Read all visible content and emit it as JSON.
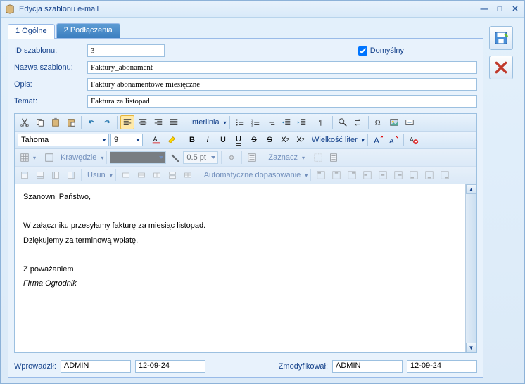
{
  "title": "Edycja szablonu e-mail",
  "tabs": {
    "general": "1 Ogólne",
    "connections": "2 Podłączenia"
  },
  "fields": {
    "id_label": "ID szablonu:",
    "id_value": "3",
    "default_label": "Domyślny",
    "default_checked": true,
    "name_label": "Nazwa szablonu:",
    "name_value": "Faktury_abonament",
    "desc_label": "Opis:",
    "desc_value": "Faktury abonamentowe miesięczne",
    "subject_label": "Temat:",
    "subject_value": "Faktura za listopad"
  },
  "toolbar": {
    "font_family": "Tahoma",
    "font_size": "9",
    "interlinia": "Interlinia",
    "wielkosc": "Wielkość liter",
    "krawedzie": "Krawędzie",
    "pt": "0.5 pt",
    "zaznacz": "Zaznacz",
    "usun": "Usuń",
    "auto": "Automatyczne dopasowanie"
  },
  "body": {
    "greeting": "Szanowni Państwo,",
    "l1": "W załączniku przesyłamy fakturę za miesiąc listopad.",
    "l2": "Dziękujemy za terminową wpłatę.",
    "sign1": "Z poważaniem",
    "sign2": "Firma Ogrodnik"
  },
  "footer": {
    "created_label": "Wprowadził:",
    "created_by": "ADMIN",
    "created_date": "12-09-24",
    "modified_label": "Zmodyfikował:",
    "modified_by": "ADMIN",
    "modified_date": "12-09-24"
  }
}
